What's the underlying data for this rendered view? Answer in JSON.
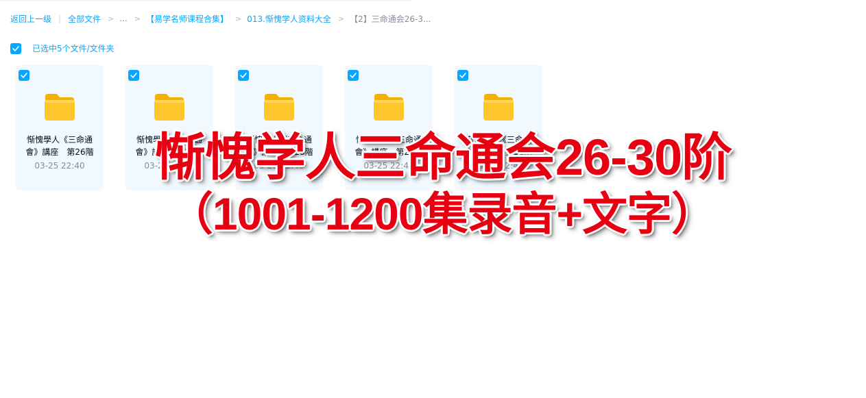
{
  "breadcrumb": {
    "back": "返回上一级",
    "all_files": "全部文件",
    "ellipsis": "...",
    "level1": "【易学名师课程合集】",
    "level2": "013.惭愧学人资料大全",
    "current": "【2】三命通会26-3..."
  },
  "selection": {
    "label": "已选中5个文件/文件夹",
    "checked": true
  },
  "files": [
    {
      "name": "惭愧學人《三命通會》講座　第26階",
      "date": "03-25 22:40",
      "checked": true
    },
    {
      "name": "惭愧學人《三命通會》講座　第27階",
      "date": "03-25 22:40",
      "checked": true
    },
    {
      "name": "惭愧學人《三命通會》講座　第28階",
      "date": "03-25 22:40",
      "checked": true
    },
    {
      "name": "惭愧學人《三命通會》講座　第29階",
      "date": "03-25 22:40",
      "checked": true
    },
    {
      "name": "惭愧學人《三命通會》講座　第30階",
      "date": "03-25 22:40",
      "checked": true
    }
  ],
  "overlay": {
    "line1": "惭愧学人三命通会26-30阶",
    "line2": "（1001-1200集录音+文字）"
  },
  "colors": {
    "accent": "#06a7ff",
    "card_bg": "#f1f9fe",
    "overlay_text": "#e60012",
    "folder": "#ffc62e"
  },
  "icons": {
    "checkbox": "check-icon",
    "file": "folder-icon"
  }
}
